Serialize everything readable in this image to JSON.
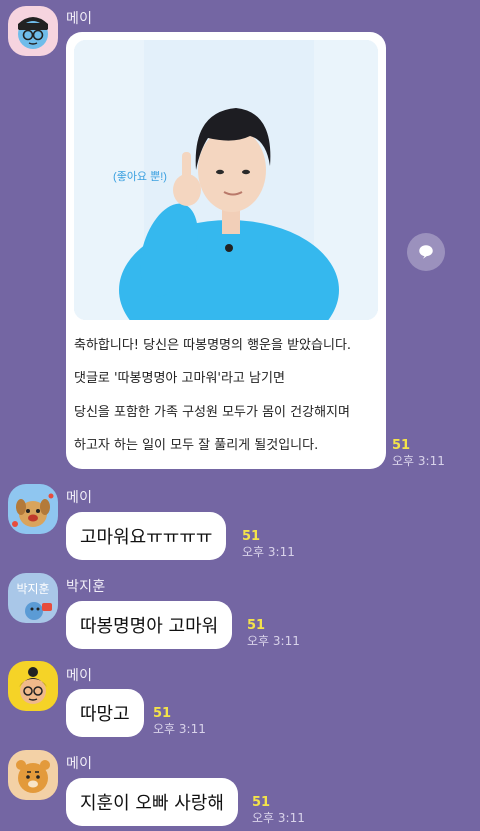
{
  "messages": {
    "m1": {
      "sender": "메이",
      "photo_caption": "(좋아요 뿐!)",
      "lines": [
        "축하합니다! 당신은 따봉명명의 행운을 받았습니다.",
        "댓글로 '따봉명명아 고마워'라고 남기면",
        "당신을 포함한 가족 구성원 모두가 몸이 건강해지며",
        "하고자 하는 일이 모두 잘 풀리게 될것입니다."
      ],
      "read_count": "51",
      "time": "오후 3:11"
    },
    "m2": {
      "sender": "메이",
      "text": "고마워요ㅠㅠㅠㅠ",
      "read_count": "51",
      "time": "오후 3:11"
    },
    "m3": {
      "sender": "박지훈",
      "avatar_label": "박지훈",
      "text": "따봉명명아 고마워",
      "read_count": "51",
      "time": "오후 3:11"
    },
    "m4": {
      "sender": "메이",
      "text": "따망고",
      "read_count": "51",
      "time": "오후 3:11"
    },
    "m5": {
      "sender": "메이",
      "text": "지훈이 오빠 사랑해",
      "read_count": "51",
      "time": "오후 3:11"
    }
  },
  "icons": {
    "share": "share-chat-icon"
  },
  "colors": {
    "background": "#7466a3",
    "read_count": "#f4e34a",
    "bubble": "#ffffff"
  }
}
